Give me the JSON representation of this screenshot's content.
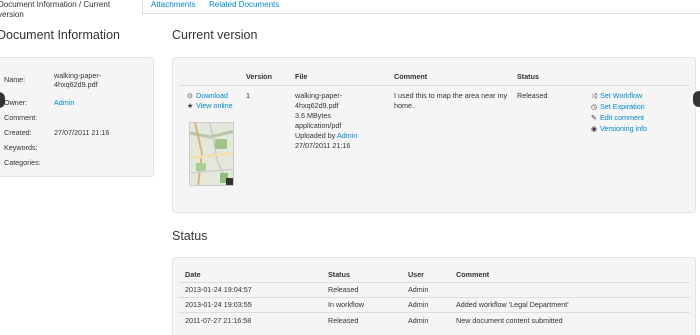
{
  "tabs": {
    "active": "Document Information / Current version",
    "attachments": "Attachments",
    "related": "Related Documents"
  },
  "docinfo": {
    "title": "Document Information",
    "rows": [
      {
        "label": "Name:",
        "value": "walking-paper-4hxq62d9.pdf"
      },
      {
        "label": "Owner:",
        "value": "Admin"
      },
      {
        "label": "Comment:",
        "value": ""
      },
      {
        "label": "Created:",
        "value": "27/07/2011 21:16"
      },
      {
        "label": "Keywords:",
        "value": ""
      },
      {
        "label": "Categories:",
        "value": ""
      }
    ]
  },
  "current": {
    "title": "Current version",
    "headers": {
      "version": "Version",
      "file": "File",
      "comment": "Comment",
      "status": "Status"
    },
    "download": "Download",
    "view_online": "View online",
    "version": "1",
    "file_lines": [
      "walking-paper-",
      "4hxq62d9.pdf",
      "3.6 MBytes",
      "application/pdf"
    ],
    "uploaded_by_label": "Uploaded by",
    "uploaded_by": "Admin",
    "uploaded_date": "27/07/2011 21:16",
    "comment": "I used this to map the area near my home.",
    "status": "Released",
    "actions": [
      "Set Workflow",
      "Set Expiration",
      "Edit comment",
      "Versioning info"
    ]
  },
  "status": {
    "title": "Status",
    "headers": {
      "date": "Date",
      "status": "Status",
      "user": "User",
      "comment": "Comment"
    },
    "rows": [
      {
        "date": "2013-01-24 19:04:57",
        "status": "Released",
        "user": "Admin",
        "comment": ""
      },
      {
        "date": "2013-01-24 19:03:55",
        "status": "In workflow",
        "user": "Admin",
        "comment": "Added workflow 'Legal Department'"
      },
      {
        "date": "2011-07-27 21:16:58",
        "status": "Released",
        "user": "Admin",
        "comment": "New document content submitted"
      }
    ]
  },
  "colors": {
    "link": "#0088cc",
    "well": "#f5f5f5"
  }
}
